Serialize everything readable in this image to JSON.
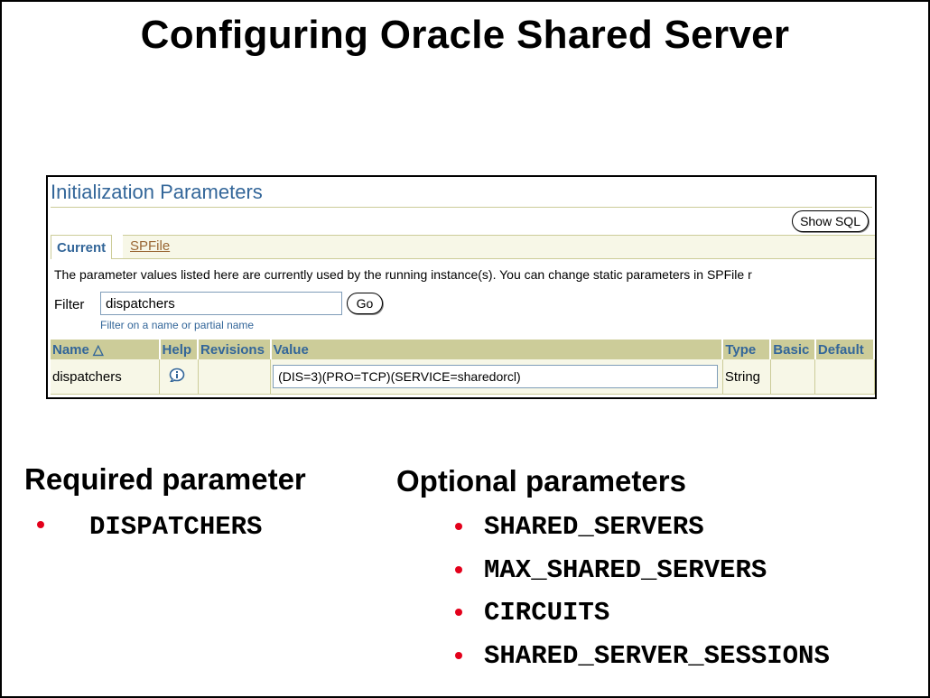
{
  "slide": {
    "title": "Configuring Oracle Shared Server"
  },
  "screenshot": {
    "page_title": "Initialization Parameters",
    "show_sql_label": "Show SQL",
    "tabs": [
      {
        "label": "Current",
        "active": true
      },
      {
        "label": "SPFile",
        "active": false
      }
    ],
    "description": "The parameter values listed here are currently used by the running instance(s).  You can change static parameters in SPFile r",
    "filter": {
      "label": "Filter",
      "value": "dispatchers",
      "hint": "Filter on a name or partial name",
      "go_label": "Go"
    },
    "table": {
      "headers": [
        "Name △",
        "Help",
        "Revisions",
        "Value",
        "Type",
        "Basic",
        "Default"
      ],
      "rows": [
        {
          "name": "dispatchers",
          "help": "info-icon",
          "revisions": "",
          "value": "(DIS=3)(PRO=TCP)(SERVICE=sharedorcl)",
          "type": "String",
          "basic": "",
          "default": ""
        }
      ]
    }
  },
  "required": {
    "heading": "Required parameter",
    "items": [
      "DISPATCHERS"
    ]
  },
  "optional": {
    "heading": "Optional parameters",
    "items": [
      "SHARED_SERVERS",
      "MAX_SHARED_SERVERS",
      "CIRCUITS",
      "SHARED_SERVER_SESSIONS"
    ]
  },
  "colors": {
    "bullet": "#e3001b",
    "header_bg": "#cccc99",
    "accent_text": "#336699",
    "row_bg": "#f7f7e7"
  }
}
